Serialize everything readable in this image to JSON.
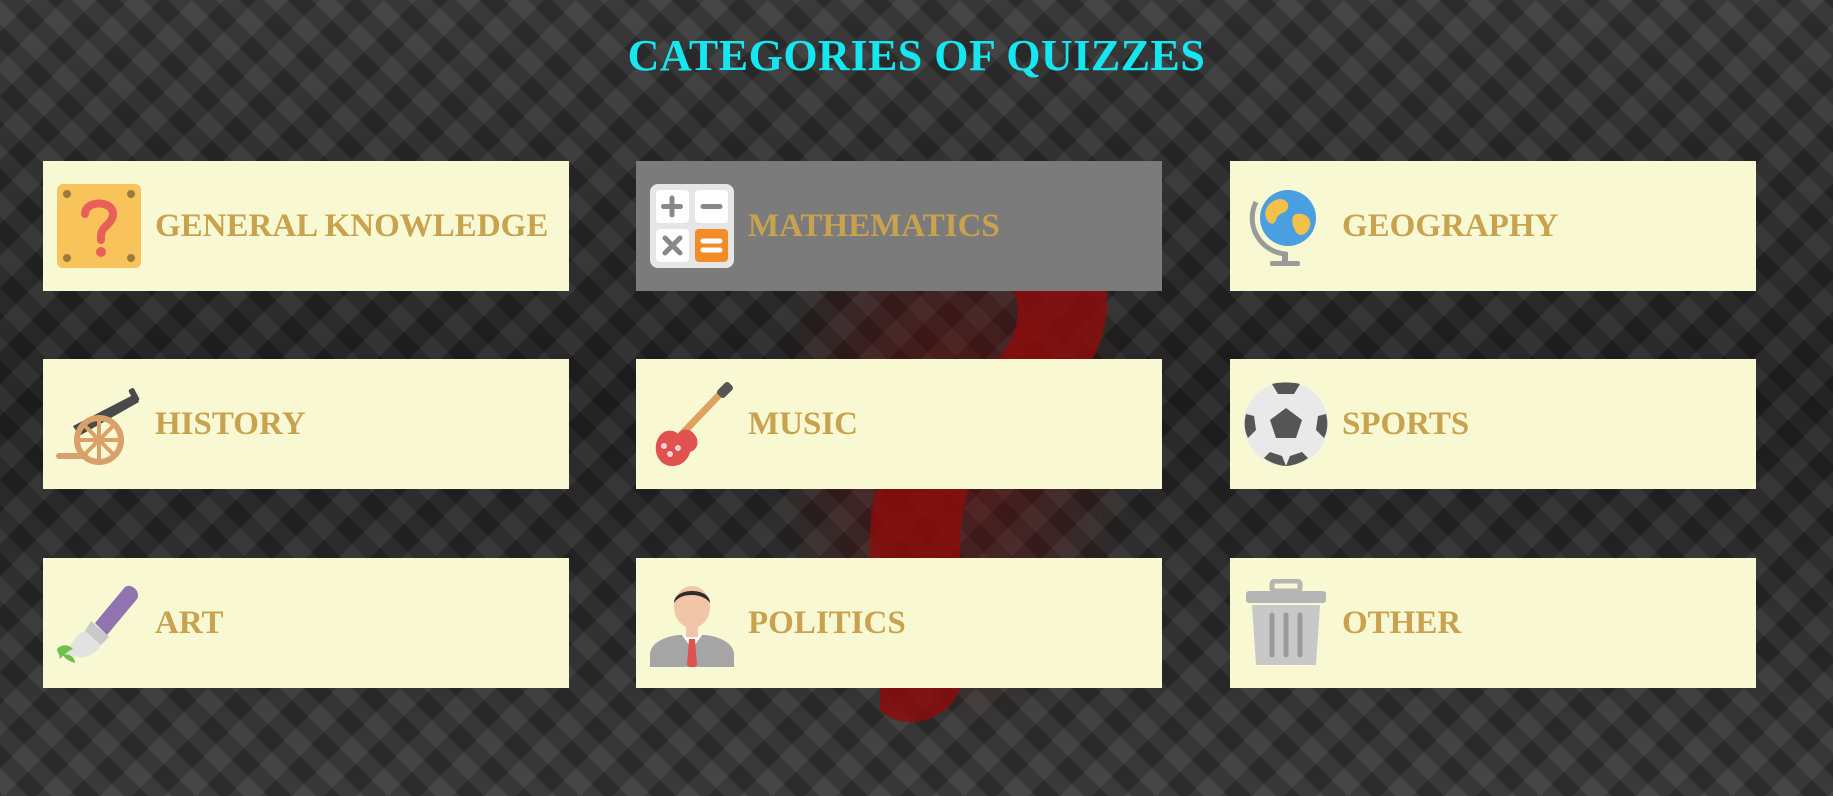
{
  "title": "CATEGORIES OF QUIZZES",
  "colors": {
    "title": "#16e6f0",
    "tile_background": "#f8f8d2",
    "tile_hover_background": "#7b7b7b",
    "tile_label": "#c9a24f"
  },
  "categories": [
    {
      "label": "GENERAL KNOWLEDGE",
      "icon": "question-box-icon"
    },
    {
      "label": "MATHEMATICS",
      "icon": "calculator-icon",
      "state": "hovered"
    },
    {
      "label": "GEOGRAPHY",
      "icon": "globe-icon"
    },
    {
      "label": "HISTORY",
      "icon": "cannon-icon"
    },
    {
      "label": "MUSIC",
      "icon": "guitar-icon"
    },
    {
      "label": "SPORTS",
      "icon": "soccer-ball-icon"
    },
    {
      "label": "ART",
      "icon": "paintbrush-icon"
    },
    {
      "label": "POLITICS",
      "icon": "politician-icon"
    },
    {
      "label": "OTHER",
      "icon": "trash-can-icon"
    }
  ]
}
